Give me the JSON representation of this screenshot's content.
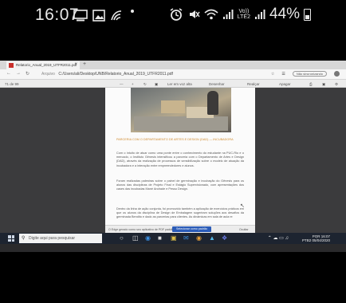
{
  "phone_status": {
    "time": "16:07",
    "battery": "44%",
    "volte_line1": "Vo))",
    "volte_line2": "LTE2"
  },
  "browser": {
    "tab_title": "Relatorio_Anual_2019_UTFR2011.pdf",
    "tab_close": "×",
    "new_tab": "+",
    "url_protocol": "Arquivo",
    "url": "C:/Users/ali/Desktop/UNB/Relatorio_Anual_2019_UTFR2011.pdf",
    "account_label": "Não sincronizando",
    "pdf_toolbar": {
      "page": "71 de 99",
      "read_aloud": "Ler em voz alta",
      "draw": "Desenhar",
      "highlight": "Realçar",
      "erase": "Apagar"
    }
  },
  "document": {
    "caption": "PARCERIA COM O DEPARTAMENTO DE ARTES E DESIGN (DAD) — INCUBADORA",
    "paragraphs": [
      "Com o intuito de atuar como uma ponte entre o conhecimento do estudante na PUC-Rio e o mercado, o Instituto Gênesis intensificou a parceria com o Departamento de Artes e Design (DAD), através da realização de processos de sensibilização sobre o modelo de atuação da incubadora e a interação entre empreendedores e alunos.",
      "Foram realizadas palestras sobre o painel de germinação e incubação do Gênesis para os alunos das disciplinas de Projeto Final e Estágio Supervisionado, com apresentações dos cases das incubadas Mané Andrade e Pesso Design.",
      "Dentro da linha de ação conjunta, foi promovido também a aplicação de exercícios práticos em que os alunos da disciplina de Design de Embalagem sugeriram soluções aos desafios da germinada Bendito e dado as parcerias para clientes. As dinâmicas em sala de aula re"
    ]
  },
  "infobar": {
    "text": "O Edge gerado como seu aplicativo de PDF padrão?",
    "button": "Selecionar como padrão",
    "dismiss": "Ocultar"
  },
  "taskbar": {
    "search_placeholder": "Digite aqui para pesquisar",
    "lang": "POR",
    "lang2": "PTB2",
    "time": "16:07",
    "date": "05/04/2020"
  }
}
